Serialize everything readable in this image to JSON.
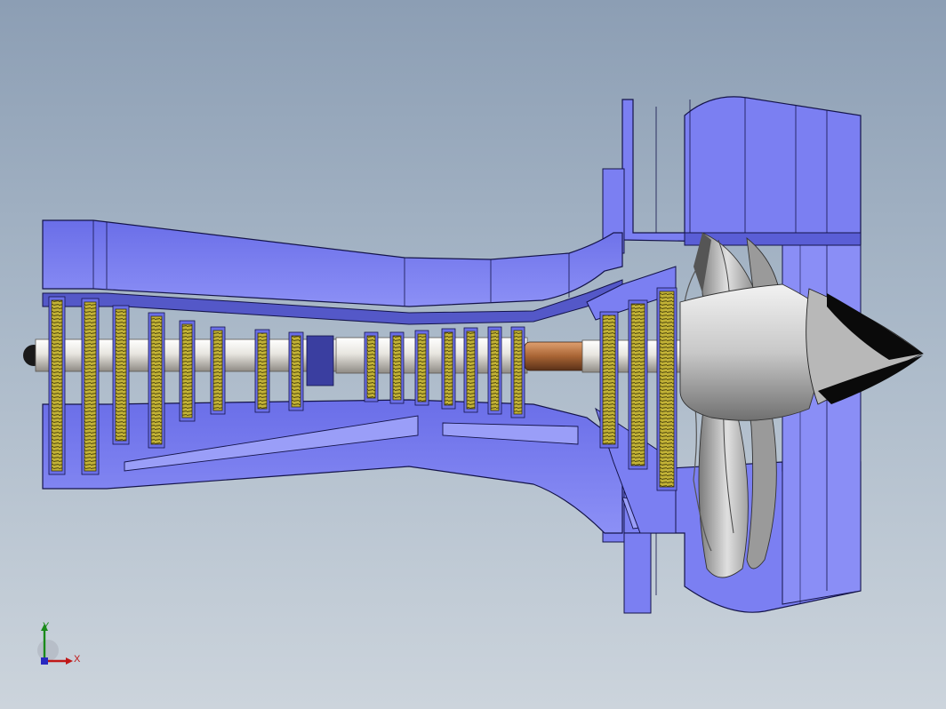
{
  "viewport": {
    "background_top": "#8c9eb4",
    "background_bottom": "#ccd4dc"
  },
  "model": {
    "colors": {
      "casing": "#7b7ff2",
      "casing_light": "#9a9ef8",
      "casing_dark": "#5458c8",
      "edge": "#14144a",
      "blade": "#b6a62c",
      "blade_dark": "#5e5410",
      "shaft": "#e8e6e0",
      "shaft_shadow": "#a8a49c",
      "coupling": "#b07040",
      "fan_blade": "#b8b8b8",
      "spinner_tip": "#0a0a0a"
    }
  },
  "triad": {
    "x_label": "X",
    "y_label": "Y",
    "icon": "coordinate-triad-icon"
  }
}
